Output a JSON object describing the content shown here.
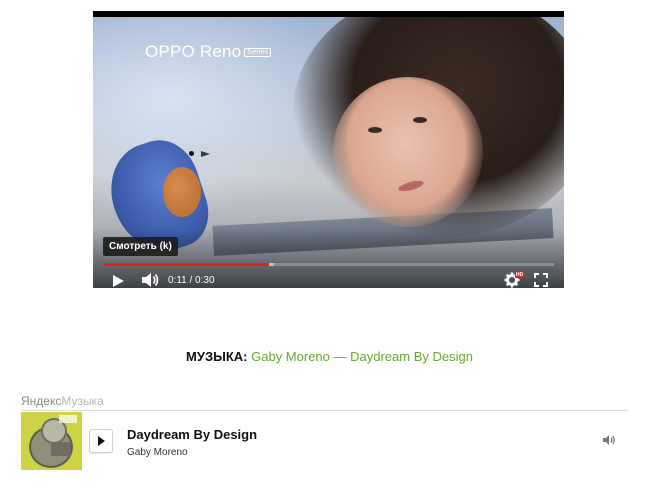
{
  "video": {
    "brand_name": "OPPO Reno",
    "brand_tag": "Series",
    "tooltip": "Смотреть (k)",
    "time": "0:11 / 0:30",
    "progress": 0.367,
    "buffered": 0.38,
    "hd_badge": "HD",
    "accent_color": "#e62117"
  },
  "credit": {
    "label": "МУЗЫКА:",
    "track_link": "Gaby Moreno — Daydream By Design",
    "link_color": "#6aa82f"
  },
  "yandex": {
    "logo_part1": "Яндекс",
    "logo_part2": "Музыка",
    "track_title": "Daydream By Design",
    "track_artist": "Gaby Moreno",
    "cover_color": "#cdd247",
    "play_icon": "play-icon",
    "volume_icon": "volume-icon"
  }
}
